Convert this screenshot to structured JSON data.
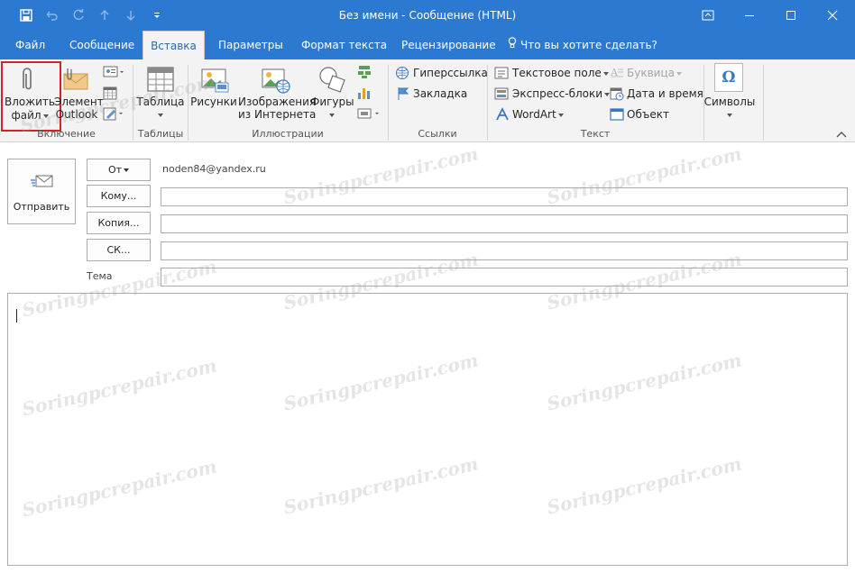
{
  "titlebar": {
    "title": "Без имени - Сообщение (HTML)"
  },
  "menu": {
    "tabs": [
      "Файл",
      "Сообщение",
      "Вставка",
      "Параметры",
      "Формат текста",
      "Рецензирование"
    ],
    "tell_me": "Что вы хотите сделать?",
    "active_tab": "Вставка"
  },
  "ribbon": {
    "include": {
      "attach_line1": "Вложить",
      "attach_line2": "файл",
      "outlook_line1": "Элемент",
      "outlook_line2": "Outlook",
      "group": "Включение"
    },
    "tables": {
      "table": "Таблица",
      "group": "Таблицы"
    },
    "illustrations": {
      "pictures": "Рисунки",
      "online_line1": "Изображения",
      "online_line2": "из Интернета",
      "shapes": "Фигуры",
      "group": "Иллюстрации"
    },
    "links": {
      "hyperlink": "Гиперссылка",
      "bookmark": "Закладка",
      "group": "Ссылки"
    },
    "text": {
      "textbox": "Текстовое поле",
      "quickparts": "Экспресс-блоки",
      "wordart": "WordArt",
      "dropcap": "Буквица",
      "datetime": "Дата и время",
      "object": "Объект",
      "group": "Текст"
    },
    "symbols": {
      "symbols": "Символы"
    }
  },
  "compose": {
    "send": "Отправить",
    "from_button": "От",
    "from_value": "noden84@yandex.ru",
    "to_button": "Кому...",
    "cc_button": "Копия...",
    "bcc_button": "СК...",
    "subject_label": "Тема",
    "to_value": "",
    "cc_value": "",
    "bcc_value": "",
    "subject_value": ""
  },
  "watermark": "Soringpcrepair.com",
  "colors": {
    "accent": "#2b79d1",
    "highlight": "#d8202a",
    "ribbon_bg": "#f3f3f3"
  }
}
